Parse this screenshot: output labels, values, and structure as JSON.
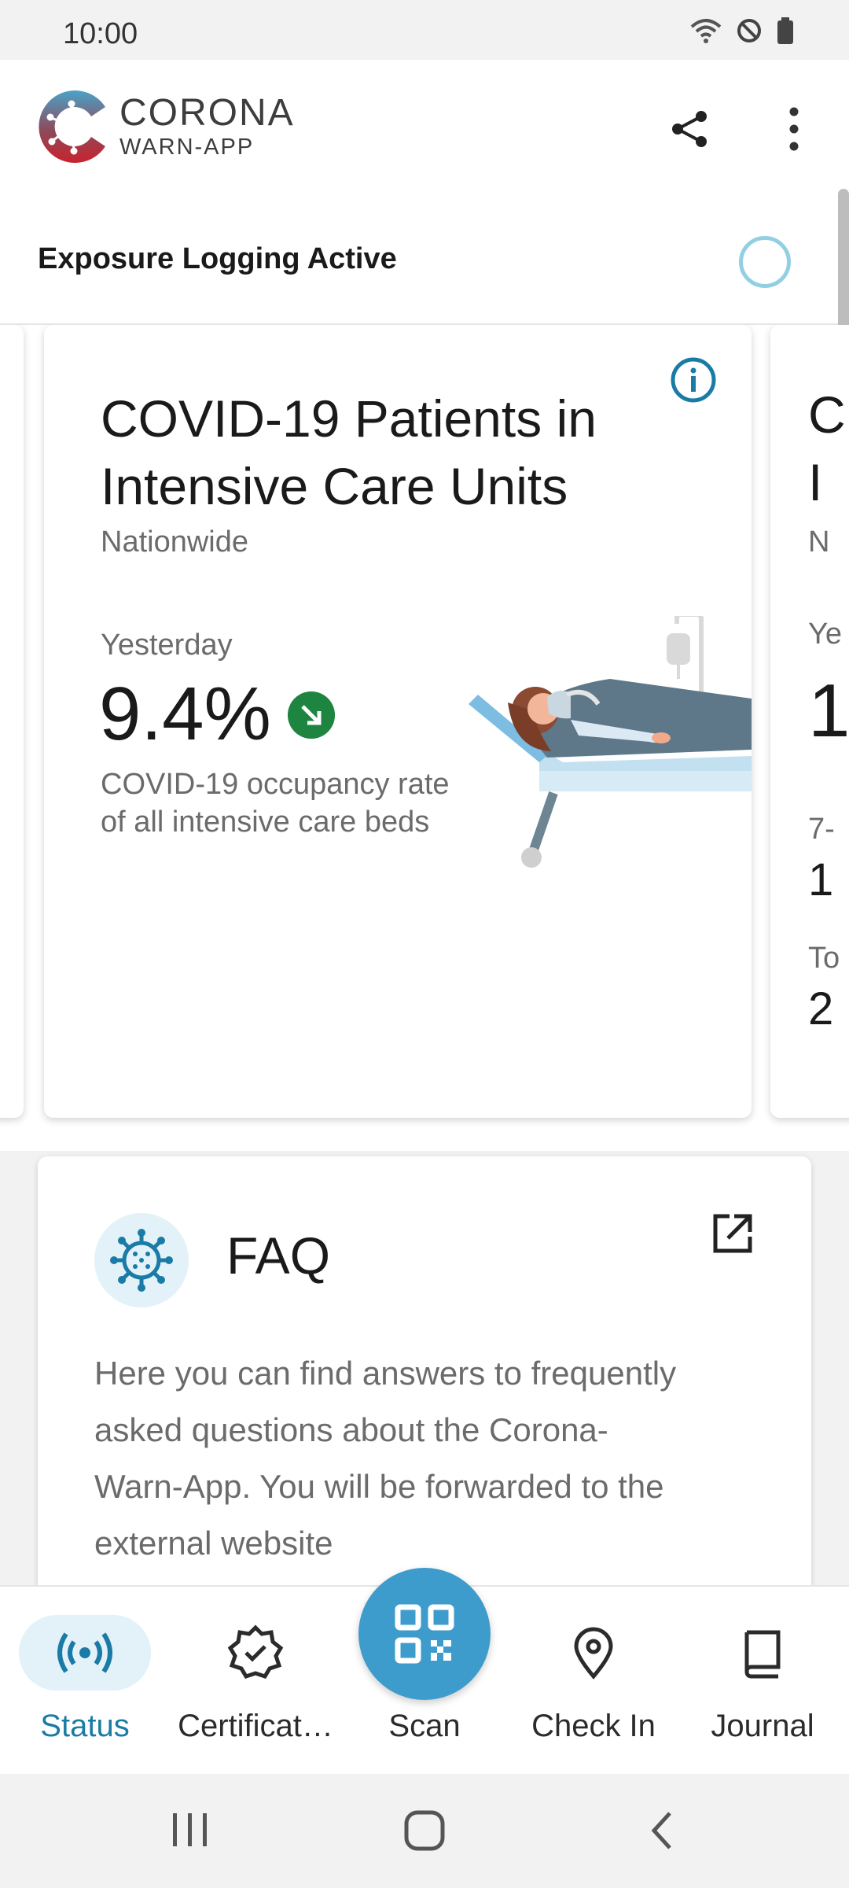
{
  "status_bar": {
    "time": "10:00",
    "icons": [
      "wifi-icon",
      "do-not-disturb-icon",
      "battery-icon"
    ]
  },
  "app_bar": {
    "brand_line1": "CORONA",
    "brand_line2": "WARN-APP",
    "actions": [
      "share-icon",
      "more-vert-icon"
    ]
  },
  "exposure": {
    "label": "Exposure Logging Active"
  },
  "statistics_card": {
    "title": "COVID-19 Patients in Intensive Care Units",
    "region": "Nationwide",
    "period": "Yesterday",
    "value": "9.4%",
    "trend": "decreasing",
    "description": "COVID-19 occupancy rate of all intensive care beds"
  },
  "peek_card": {
    "fragments": [
      "C",
      "I",
      "N",
      "Ye",
      "1",
      "7-",
      "1",
      "To",
      "2"
    ]
  },
  "faq": {
    "title": "FAQ",
    "body": "Here you can find answers to frequently asked questions about the Corona-Warn-App. You will be forwarded to the external website"
  },
  "bottom_nav": {
    "items": [
      {
        "label": "Status",
        "icon": "status-icon",
        "active": true
      },
      {
        "label": "Certificat…",
        "icon": "certificate-icon",
        "active": false
      },
      {
        "label": "Scan",
        "icon": "qr-scan-icon",
        "active": false
      },
      {
        "label": "Check In",
        "icon": "location-pin-icon",
        "active": false
      },
      {
        "label": "Journal",
        "icon": "journal-icon",
        "active": false
      }
    ]
  },
  "colors": {
    "accent": "#1a7ba6",
    "scan_button": "#3e9ccc",
    "trend_down": "#1e8540",
    "ring": "#93cfe2"
  }
}
